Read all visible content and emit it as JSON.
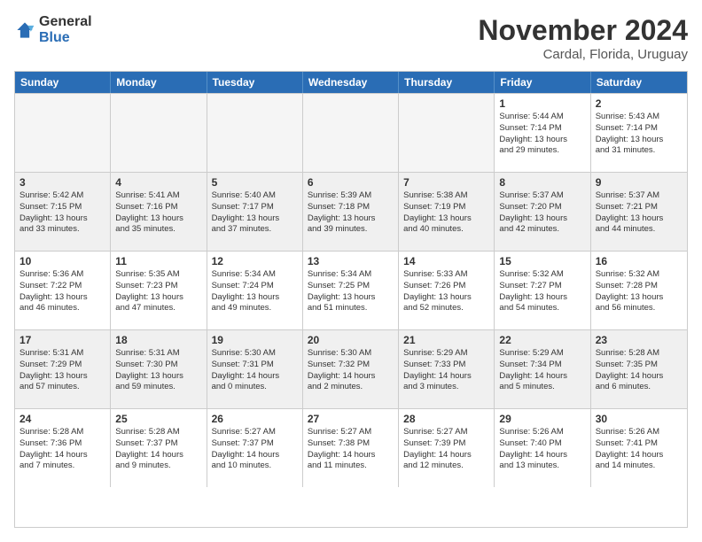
{
  "logo": {
    "general": "General",
    "blue": "Blue"
  },
  "header": {
    "month": "November 2024",
    "location": "Cardal, Florida, Uruguay"
  },
  "days": [
    "Sunday",
    "Monday",
    "Tuesday",
    "Wednesday",
    "Thursday",
    "Friday",
    "Saturday"
  ],
  "weeks": [
    [
      {
        "day": "",
        "empty": true
      },
      {
        "day": "",
        "empty": true
      },
      {
        "day": "",
        "empty": true
      },
      {
        "day": "",
        "empty": true
      },
      {
        "day": "",
        "empty": true
      },
      {
        "day": "1",
        "text": "Sunrise: 5:44 AM\nSunset: 7:14 PM\nDaylight: 13 hours\nand 29 minutes."
      },
      {
        "day": "2",
        "text": "Sunrise: 5:43 AM\nSunset: 7:14 PM\nDaylight: 13 hours\nand 31 minutes."
      }
    ],
    [
      {
        "day": "3",
        "text": "Sunrise: 5:42 AM\nSunset: 7:15 PM\nDaylight: 13 hours\nand 33 minutes."
      },
      {
        "day": "4",
        "text": "Sunrise: 5:41 AM\nSunset: 7:16 PM\nDaylight: 13 hours\nand 35 minutes."
      },
      {
        "day": "5",
        "text": "Sunrise: 5:40 AM\nSunset: 7:17 PM\nDaylight: 13 hours\nand 37 minutes."
      },
      {
        "day": "6",
        "text": "Sunrise: 5:39 AM\nSunset: 7:18 PM\nDaylight: 13 hours\nand 39 minutes."
      },
      {
        "day": "7",
        "text": "Sunrise: 5:38 AM\nSunset: 7:19 PM\nDaylight: 13 hours\nand 40 minutes."
      },
      {
        "day": "8",
        "text": "Sunrise: 5:37 AM\nSunset: 7:20 PM\nDaylight: 13 hours\nand 42 minutes."
      },
      {
        "day": "9",
        "text": "Sunrise: 5:37 AM\nSunset: 7:21 PM\nDaylight: 13 hours\nand 44 minutes."
      }
    ],
    [
      {
        "day": "10",
        "text": "Sunrise: 5:36 AM\nSunset: 7:22 PM\nDaylight: 13 hours\nand 46 minutes."
      },
      {
        "day": "11",
        "text": "Sunrise: 5:35 AM\nSunset: 7:23 PM\nDaylight: 13 hours\nand 47 minutes."
      },
      {
        "day": "12",
        "text": "Sunrise: 5:34 AM\nSunset: 7:24 PM\nDaylight: 13 hours\nand 49 minutes."
      },
      {
        "day": "13",
        "text": "Sunrise: 5:34 AM\nSunset: 7:25 PM\nDaylight: 13 hours\nand 51 minutes."
      },
      {
        "day": "14",
        "text": "Sunrise: 5:33 AM\nSunset: 7:26 PM\nDaylight: 13 hours\nand 52 minutes."
      },
      {
        "day": "15",
        "text": "Sunrise: 5:32 AM\nSunset: 7:27 PM\nDaylight: 13 hours\nand 54 minutes."
      },
      {
        "day": "16",
        "text": "Sunrise: 5:32 AM\nSunset: 7:28 PM\nDaylight: 13 hours\nand 56 minutes."
      }
    ],
    [
      {
        "day": "17",
        "text": "Sunrise: 5:31 AM\nSunset: 7:29 PM\nDaylight: 13 hours\nand 57 minutes."
      },
      {
        "day": "18",
        "text": "Sunrise: 5:31 AM\nSunset: 7:30 PM\nDaylight: 13 hours\nand 59 minutes."
      },
      {
        "day": "19",
        "text": "Sunrise: 5:30 AM\nSunset: 7:31 PM\nDaylight: 14 hours\nand 0 minutes."
      },
      {
        "day": "20",
        "text": "Sunrise: 5:30 AM\nSunset: 7:32 PM\nDaylight: 14 hours\nand 2 minutes."
      },
      {
        "day": "21",
        "text": "Sunrise: 5:29 AM\nSunset: 7:33 PM\nDaylight: 14 hours\nand 3 minutes."
      },
      {
        "day": "22",
        "text": "Sunrise: 5:29 AM\nSunset: 7:34 PM\nDaylight: 14 hours\nand 5 minutes."
      },
      {
        "day": "23",
        "text": "Sunrise: 5:28 AM\nSunset: 7:35 PM\nDaylight: 14 hours\nand 6 minutes."
      }
    ],
    [
      {
        "day": "24",
        "text": "Sunrise: 5:28 AM\nSunset: 7:36 PM\nDaylight: 14 hours\nand 7 minutes."
      },
      {
        "day": "25",
        "text": "Sunrise: 5:28 AM\nSunset: 7:37 PM\nDaylight: 14 hours\nand 9 minutes."
      },
      {
        "day": "26",
        "text": "Sunrise: 5:27 AM\nSunset: 7:37 PM\nDaylight: 14 hours\nand 10 minutes."
      },
      {
        "day": "27",
        "text": "Sunrise: 5:27 AM\nSunset: 7:38 PM\nDaylight: 14 hours\nand 11 minutes."
      },
      {
        "day": "28",
        "text": "Sunrise: 5:27 AM\nSunset: 7:39 PM\nDaylight: 14 hours\nand 12 minutes."
      },
      {
        "day": "29",
        "text": "Sunrise: 5:26 AM\nSunset: 7:40 PM\nDaylight: 14 hours\nand 13 minutes."
      },
      {
        "day": "30",
        "text": "Sunrise: 5:26 AM\nSunset: 7:41 PM\nDaylight: 14 hours\nand 14 minutes."
      }
    ]
  ]
}
